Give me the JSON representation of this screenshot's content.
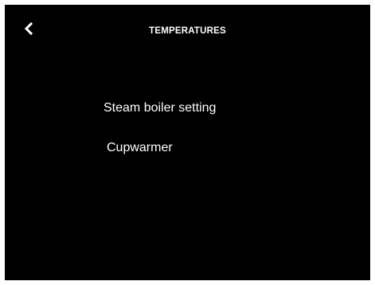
{
  "header": {
    "title": "TEMPERATURES",
    "back_icon": "chevron-left-icon"
  },
  "menu": {
    "items": [
      {
        "label": "Steam boiler setting"
      },
      {
        "label": "Cupwarmer"
      }
    ]
  },
  "colors": {
    "background": "#000000",
    "text": "#ffffff",
    "frame": "#ffffff"
  }
}
